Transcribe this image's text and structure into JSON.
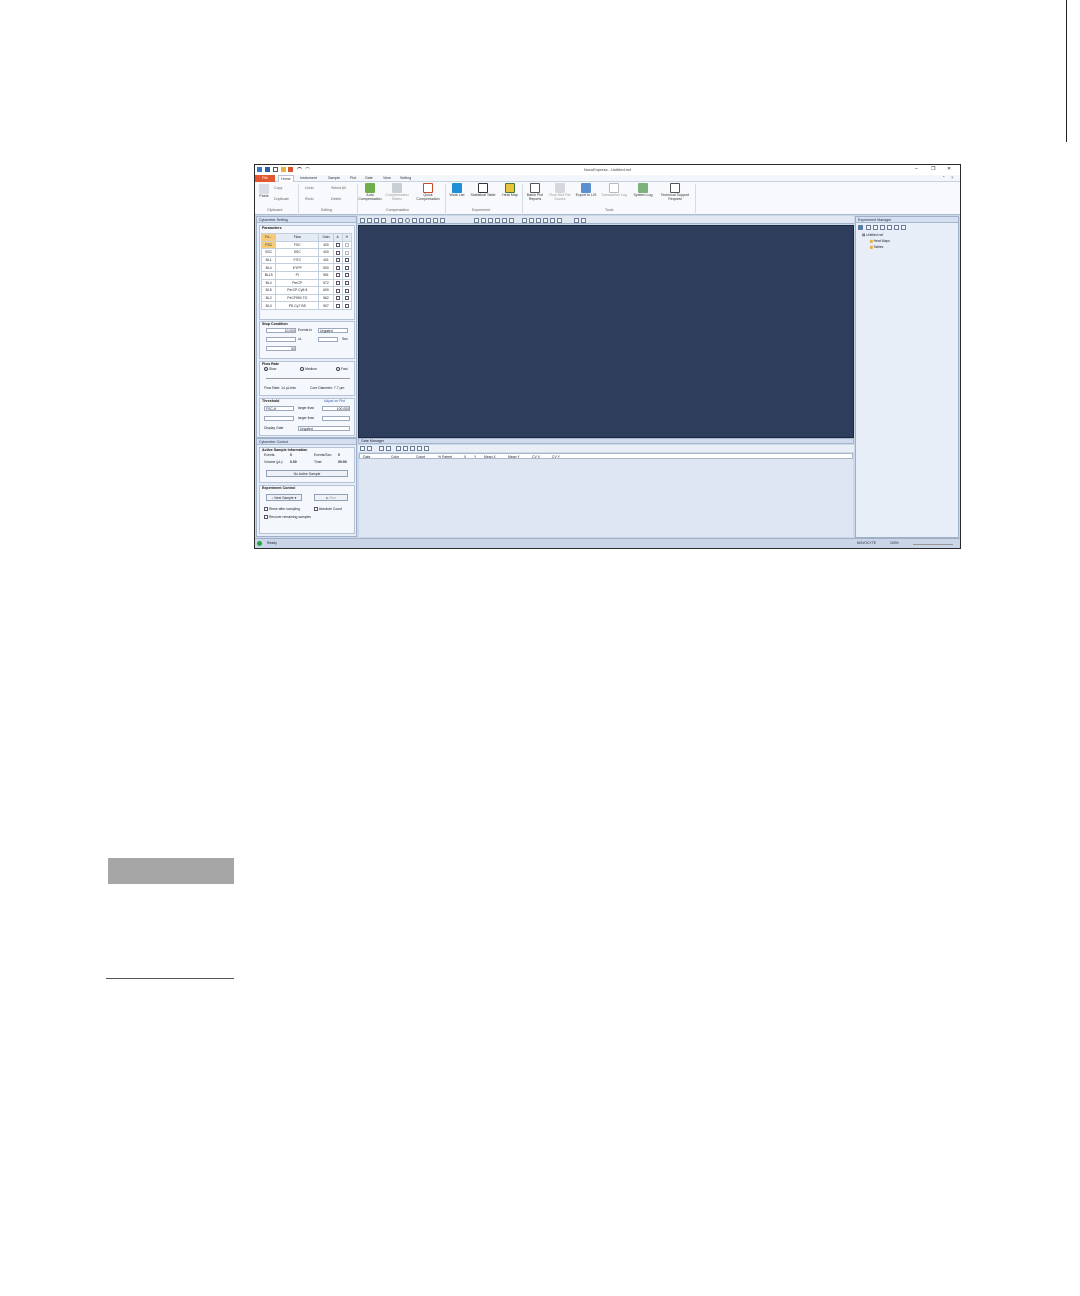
{
  "window": {
    "title": "NovoExpress - Untitled.nxf"
  },
  "tabs": {
    "file": "File",
    "home": "Home",
    "instrument": "Instrument",
    "sample": "Sample",
    "plot": "Plot",
    "gate": "Gate",
    "view": "View",
    "setting": "Setting"
  },
  "ribbon": {
    "paste": "Paste",
    "copy": "Copy",
    "duplicate": "Duplicate",
    "undo": "Undo",
    "redo": "Redo",
    "select_all": "Select All",
    "delete": "Delete",
    "auto_comp": "Auto Compensation",
    "comp_matrix": "Compensation Matrix",
    "quick_comp": "Quick Compensation",
    "work_list": "Work List",
    "statistical_table": "Statistical Table",
    "heat_map": "Heat Map",
    "batch_plot": "Batch Plot Reports",
    "flow_hist": "Flow Hist File Source",
    "export_lis": "Export to LIS",
    "transaction_log": "Transaction Log",
    "system_log": "System Log",
    "tech_support": "Technical Support Request",
    "grp_clipboard": "Clipboard",
    "grp_editing": "Editing",
    "grp_compensation": "Compensation",
    "grp_experiment": "Experiment",
    "grp_tools": "Tools"
  },
  "cytometer": {
    "panel_title": "Cytometer Setting",
    "parameters_title": "Parameters",
    "table_headers": [
      "Fo...",
      "Flow",
      "Gain",
      "A",
      "H"
    ],
    "rows": [
      [
        "FSC",
        "FSC",
        "400"
      ],
      [
        "SSC",
        "SSC",
        "400"
      ],
      [
        "BL1",
        "FITC",
        "401"
      ],
      [
        "BL4",
        "EYFP",
        "500"
      ],
      [
        "BL15",
        "PI",
        "551"
      ],
      [
        "BL4",
        "PerCP",
        "572"
      ],
      [
        "BL5",
        "PerCP-Cy5.5",
        "600"
      ],
      [
        "BL2",
        "PeCF594 TO",
        "562"
      ],
      [
        "BL3",
        "PE-Cy7 BS",
        "507"
      ]
    ],
    "stop_title": "Stop Condition",
    "stop_value": "10,000",
    "events_in": "Events in",
    "ungated": "Ungated",
    "ul": "uL",
    "sec": "Sec",
    "pct": "50",
    "flow_rate_title": "Flow Rate",
    "slow": "Slow",
    "medium": "Medium",
    "fast": "Fast",
    "flow_rate_label": "Flow Rate: 14 µL/min",
    "core_diameter": "Core Diameter: 7.7 µm",
    "threshold_title": "Threshold",
    "adjust_on_plot": "Adjust on Plot",
    "fsc_h": "FSC-H",
    "larger_than": "larger than",
    "threshold_val": "100,000",
    "display_gate": "Display Gate",
    "gate_val": "Ungated"
  },
  "cytometer_control": {
    "title": "Cytometer Control",
    "active_title": "Active Sample Information",
    "events": "Events:",
    "events_val": "0",
    "events_sec": "Events/Sec:",
    "events_sec_val": "0",
    "volume": "Volume (µL):",
    "volume_val": "0.00",
    "time": "Time:",
    "time_val": "00:00",
    "no_active": "No Active Sample",
    "exp_title": "Experiment Control",
    "next_sample": "Next Sample",
    "run": "Run",
    "rinse": "Rinse after sampling",
    "absolute": "Absolute Count",
    "recover": "Recover remaining samples"
  },
  "gate_manager": {
    "title": "Gate Manager",
    "columns": [
      "Gate",
      "Color",
      "Count",
      "% Parent",
      "X",
      "Y",
      "Mean X",
      "Mean Y",
      "CV X",
      "CV Y"
    ]
  },
  "experiment_manager": {
    "title": "Experiment Manager",
    "root": "Untitled.nxf",
    "heat_maps": "Heat Maps",
    "tables": "Tables"
  },
  "status": {
    "text": "Ready",
    "connected": "NOVOCYTE",
    "zoom": "100%"
  }
}
